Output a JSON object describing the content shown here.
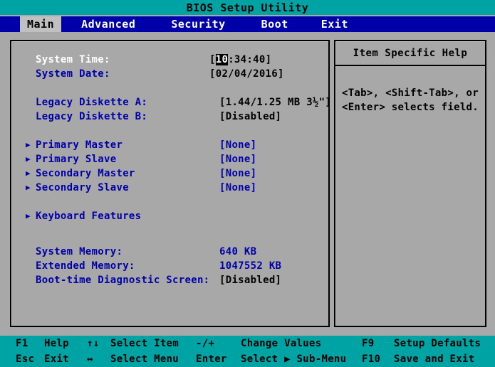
{
  "window": {
    "title": "BIOS Setup Utility"
  },
  "menubar": {
    "tabs": [
      {
        "label": "Main",
        "active": true
      },
      {
        "label": "Advanced",
        "active": false
      },
      {
        "label": "Security",
        "active": false
      },
      {
        "label": "Boot",
        "active": false
      },
      {
        "label": "Exit",
        "active": false
      }
    ]
  },
  "main_panel": {
    "rows": [
      {
        "label": "System Time:",
        "value_pre": "[",
        "value_cursor": "10",
        "value_post": ":34:40]",
        "selected": true
      },
      {
        "label": "System Date:",
        "value": "[02/04/2016]"
      },
      {
        "label": "Legacy Diskette A:",
        "value": "[1.44/1.25 MB   3½\"]"
      },
      {
        "label": "Legacy Diskette B:",
        "value": "[Disabled]"
      },
      {
        "label": "Primary Master",
        "value": "[None]",
        "submenu": true
      },
      {
        "label": "Primary Slave",
        "value": "[None]",
        "submenu": true
      },
      {
        "label": "Secondary Master",
        "value": "[None]",
        "submenu": true
      },
      {
        "label": "Secondary Slave",
        "value": "[None]",
        "submenu": true
      },
      {
        "label": "Keyboard Features",
        "value": "",
        "submenu": true
      },
      {
        "label": "System Memory:",
        "value": "640 KB",
        "value_blue": true
      },
      {
        "label": "Extended Memory:",
        "value": "1047552 KB",
        "value_blue": true
      },
      {
        "label": "Boot-time Diagnostic Screen:",
        "value": "[Disabled]"
      }
    ]
  },
  "help_panel": {
    "title": "Item Specific Help",
    "line1": "<Tab>, <Shift-Tab>, or",
    "line2": "<Enter> selects field."
  },
  "footer": {
    "row1": [
      {
        "key": "F1",
        "label": "Help"
      },
      {
        "key": "↑↓",
        "label": "Select Item"
      },
      {
        "key": "-/+",
        "label": "Change Values"
      },
      {
        "key": "F9",
        "label": "Setup Defaults"
      }
    ],
    "row2": [
      {
        "key": "Esc",
        "label": "Exit"
      },
      {
        "key": "↔",
        "label": "Select Menu"
      },
      {
        "key": "Enter",
        "label": "Select ▶ Sub-Menu"
      },
      {
        "key": "F10",
        "label": "Save and Exit"
      }
    ]
  },
  "colors": {
    "title_bar": "#00a3a3",
    "menu_bar": "#0000a8",
    "panel_bg": "#a8a8a8",
    "label_blue": "#0000a8",
    "selected_white": "#ffffff",
    "footer_bar": "#00a3a3"
  }
}
